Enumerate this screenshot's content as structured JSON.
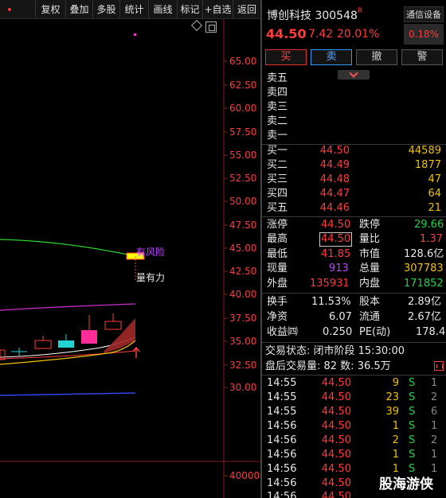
{
  "toolbar": {
    "items": [
      "复权",
      "叠加",
      "多股",
      "统计",
      "画线",
      "标记",
      "+自选",
      "返回"
    ]
  },
  "chart": {
    "price_ticks": [
      "65.00",
      "62.50",
      "60.00",
      "57.50",
      "55.00",
      "52.50",
      "50.00",
      "47.50",
      "45.00",
      "42.50",
      "40.00",
      "37.50",
      "35.00",
      "32.50",
      "30.00"
    ],
    "volume_tick": "40000",
    "annotation_risk": "有风险",
    "annotation_support": "量有力"
  },
  "stock": {
    "name_code": "博创科技 300548",
    "badge": "R",
    "price": "44.50",
    "change": "7.42",
    "change_pct": "20.01%",
    "device_label": "通信设备",
    "device_pct": "0.18%"
  },
  "actions": {
    "buy": "买",
    "sell": "卖",
    "cancel": "撤",
    "alert": "警"
  },
  "sell_orders": [
    {
      "label": "卖五",
      "price": "",
      "volume": ""
    },
    {
      "label": "卖四",
      "price": "",
      "volume": ""
    },
    {
      "label": "卖三",
      "price": "",
      "volume": ""
    },
    {
      "label": "卖二",
      "price": "",
      "volume": ""
    },
    {
      "label": "卖一",
      "price": "",
      "volume": ""
    }
  ],
  "buy_orders": [
    {
      "label": "买一",
      "price": "44.50",
      "volume": "44589"
    },
    {
      "label": "买二",
      "price": "44.49",
      "volume": "1877"
    },
    {
      "label": "买三",
      "price": "44.48",
      "volume": "47"
    },
    {
      "label": "买四",
      "price": "44.47",
      "volume": "64"
    },
    {
      "label": "买五",
      "price": "44.46",
      "volume": "21"
    }
  ],
  "stats1": {
    "limit_up_label": "涨停",
    "limit_up": "44.50",
    "limit_down_label": "跌停",
    "limit_down": "29.66",
    "high_label": "最高",
    "high": "44.50",
    "vol_ratio_label": "量比",
    "vol_ratio": "1.37",
    "low_label": "最低",
    "low": "41.85",
    "mkt_cap_label": "市值",
    "mkt_cap": "128.6亿",
    "current_label": "现量",
    "current": "913",
    "total_vol_label": "总量",
    "total_vol": "307783",
    "outer_label": "外盘",
    "outer": "135931",
    "inner_label": "内盘",
    "inner": "171852"
  },
  "stats2": {
    "turnover_label": "换手",
    "turnover": "11.53%",
    "shares_label": "股本",
    "shares": "2.89亿",
    "nav_label": "净资",
    "nav": "6.07",
    "float_label": "流通",
    "float": "2.67亿",
    "eps_label": "收益㈣",
    "eps": "0.250",
    "pe_label": "PE(动)",
    "pe": "178.4"
  },
  "trade_status": "交易状态: 闭市阶段 15:30:00",
  "after_hours": "盘后交易量: 82  数: 36.5万",
  "ticks": [
    {
      "time": "14:55",
      "price": "44.50",
      "vol": "9",
      "side": "S",
      "n": "1"
    },
    {
      "time": "14:55",
      "price": "44.50",
      "vol": "23",
      "side": "S",
      "n": "2"
    },
    {
      "time": "14:55",
      "price": "44.50",
      "vol": "39",
      "side": "S",
      "n": "6"
    },
    {
      "time": "14:56",
      "price": "44.50",
      "vol": "1",
      "side": "S",
      "n": "1"
    },
    {
      "time": "14:56",
      "price": "44.50",
      "vol": "2",
      "side": "S",
      "n": "2"
    },
    {
      "time": "14:56",
      "price": "44.50",
      "vol": "1",
      "side": "S",
      "n": "1"
    },
    {
      "time": "14:56",
      "price": "44.50",
      "vol": "1",
      "side": "S",
      "n": "1"
    },
    {
      "time": "14:56",
      "price": "44.50",
      "vol": "",
      "side": "",
      "n": ""
    },
    {
      "time": "14:56",
      "price": "44.50",
      "vol": "",
      "side": "",
      "n": ""
    }
  ],
  "watermark": "股海游侠",
  "colors": {
    "up": "#ff3b3b",
    "down": "#22d34a",
    "volume": "#f2c200",
    "background": "#000000"
  }
}
